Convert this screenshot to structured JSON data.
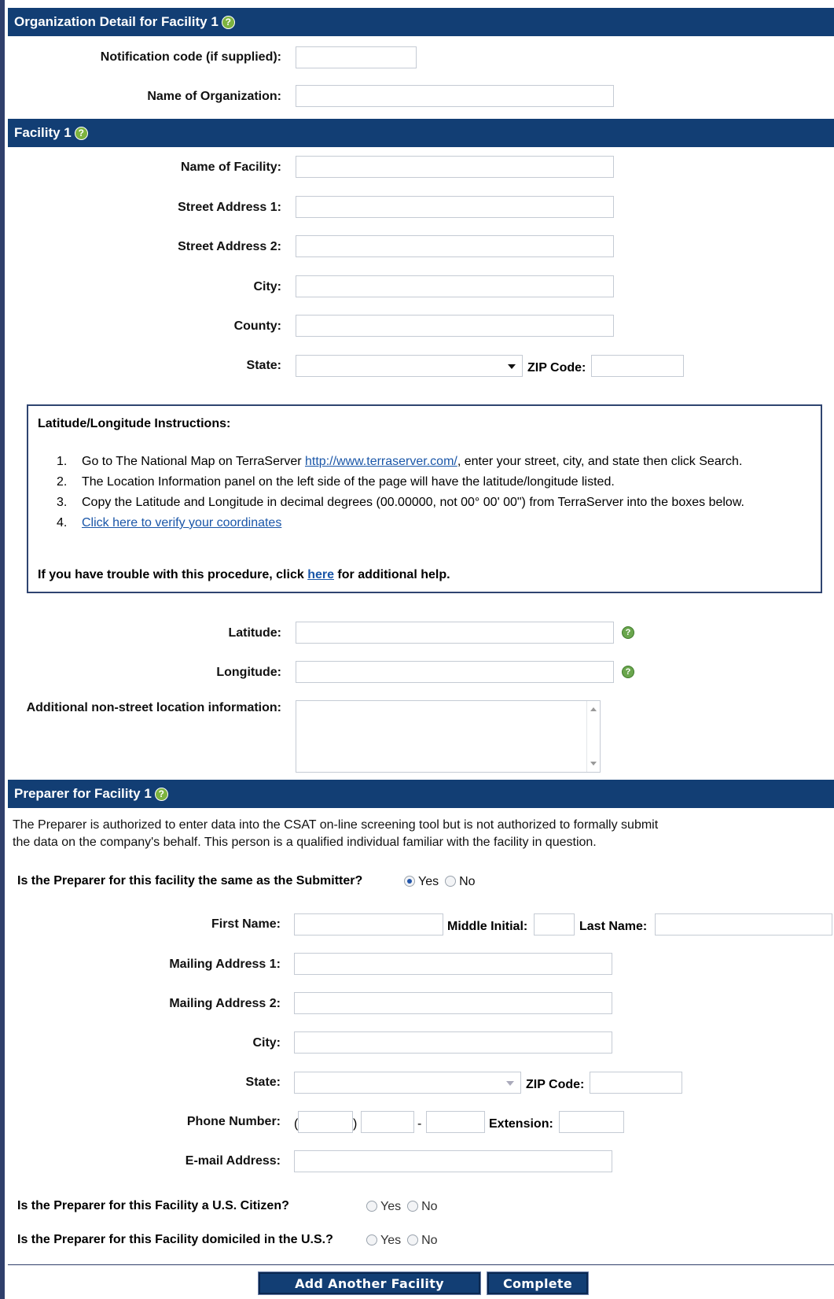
{
  "org_section": {
    "title": "Organization Detail for Facility 1",
    "notification_label": "Notification code (if supplied):",
    "org_name_label": "Name of Organization:"
  },
  "facility_section": {
    "title": "Facility 1",
    "name_label": "Name of Facility:",
    "street1_label": "Street Address 1:",
    "street2_label": "Street Address 2:",
    "city_label": "City:",
    "county_label": "County:",
    "state_label": "State:",
    "zip_label": "ZIP Code:"
  },
  "latlong_instructions": {
    "title": "Latitude/Longitude Instructions:",
    "steps": [
      {
        "num": "1.",
        "before": "Go to The National Map on TerraServer ",
        "link": "http://www.terraserver.com/",
        "after": ", enter your street, city, and state then click Search."
      },
      {
        "num": "2.",
        "text": "The Location Information panel on the left side of the page will have the latitude/longitude listed."
      },
      {
        "num": "3.",
        "text": "Copy the Latitude and Longitude in decimal degrees (00.00000, not 00° 00' 00\") from TerraServer into the boxes below."
      },
      {
        "num": "4.",
        "link": "Click here to verify your coordinates"
      }
    ],
    "help_before": "If you have trouble with this procedure, click ",
    "help_link": "here",
    "help_after": " for additional help."
  },
  "location": {
    "latitude_label": "Latitude:",
    "longitude_label": "Longitude:",
    "additional_label": "Additional non-street location information:"
  },
  "preparer_section": {
    "title": "Preparer for Facility 1",
    "description_line1": "The Preparer is authorized to enter data into the CSAT on-line screening tool but is not authorized to formally submit",
    "description_line2": "the data on the company's behalf. This person is a qualified individual familiar with the facility in question.",
    "same_question": "Is the Preparer for this facility the same as the Submitter?",
    "same_selected": "Yes",
    "yes_label": "Yes",
    "no_label": "No",
    "first_name_label": "First Name:",
    "middle_initial_label": "Middle Initial:",
    "last_name_label": "Last Name:",
    "mailing1_label": "Mailing Address 1:",
    "mailing2_label": "Mailing Address 2:",
    "city_label": "City:",
    "state_label": "State:",
    "zip_label": "ZIP Code:",
    "phone_label": "Phone Number:",
    "phone_open_paren": "(",
    "phone_close_paren": ")",
    "phone_dash": "-",
    "extension_label": "Extension:",
    "email_label": "E-mail Address:",
    "citizen_question": "Is the Preparer for this Facility a U.S. Citizen?",
    "domiciled_question": "Is the Preparer for this Facility domiciled in the U.S.?"
  },
  "buttons": {
    "add_facility": "Add Another Facility",
    "complete": "Complete"
  },
  "help_icon_glyph": "?",
  "colors": {
    "header_bg": "#123e74",
    "link": "#1a56a8",
    "help_icon": "#7db33f"
  }
}
